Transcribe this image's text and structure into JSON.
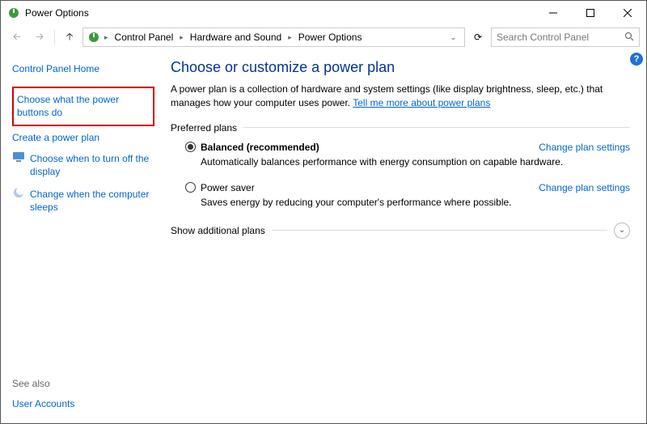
{
  "window": {
    "title": "Power Options"
  },
  "breadcrumb": {
    "items": [
      "Control Panel",
      "Hardware and Sound",
      "Power Options"
    ]
  },
  "search": {
    "placeholder": "Search Control Panel"
  },
  "sidebar": {
    "home": "Control Panel Home",
    "items": [
      "Choose what the power buttons do",
      "Create a power plan",
      "Choose when to turn off the display",
      "Change when the computer sleeps"
    ],
    "see_also_label": "See also",
    "see_also_items": [
      "User Accounts"
    ]
  },
  "main": {
    "heading": "Choose or customize a power plan",
    "description_pre": "A power plan is a collection of hardware and system settings (like display brightness, sleep, etc.) that manages how your computer uses power. ",
    "description_link": "Tell me more about power plans",
    "preferred_label": "Preferred plans",
    "plans": [
      {
        "name": "Balanced (recommended)",
        "desc": "Automatically balances performance with energy consumption on capable hardware.",
        "link": "Change plan settings",
        "checked": true
      },
      {
        "name": "Power saver",
        "desc": "Saves energy by reducing your computer's performance where possible.",
        "link": "Change plan settings",
        "checked": false
      }
    ],
    "show_additional": "Show additional plans"
  }
}
